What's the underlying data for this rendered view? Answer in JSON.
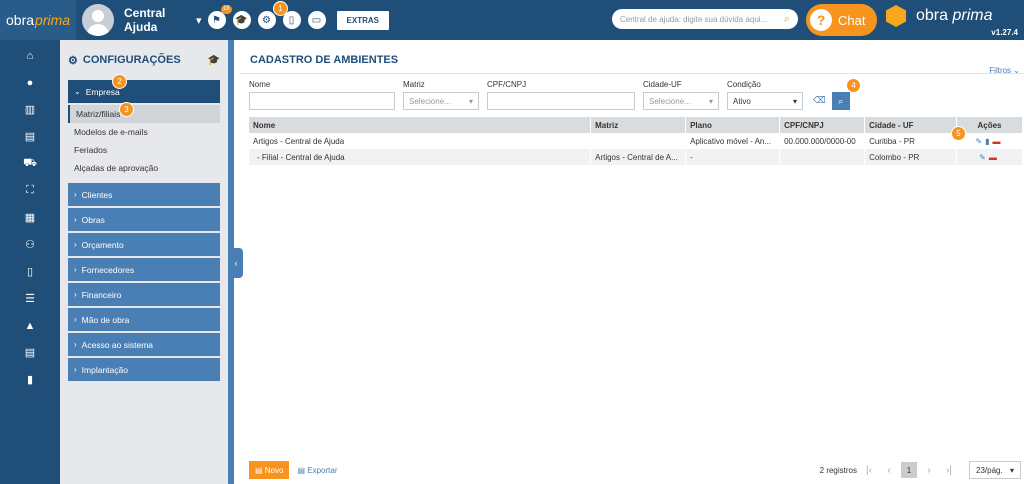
{
  "topbar": {
    "logo_a": "obra",
    "logo_b": "prima",
    "user_line1": "Central",
    "user_line2": "Ajuda",
    "notification_count": "18",
    "extras_label": "EXTRAS",
    "search_placeholder": "Central de ajuda: digite sua dúvida aqui...",
    "chat_label": "Chat",
    "brand_a": "obra",
    "brand_b": "prima",
    "version": "v1.27.4"
  },
  "sidebar": {
    "title": "CONFIGURAÇÕES",
    "active_group": "Empresa",
    "subitems": [
      "Matriz/filiais",
      "Modelos de e-mails",
      "Feriados",
      "Alçadas de aprovação"
    ],
    "groups": [
      "Clientes",
      "Obras",
      "Orçamento",
      "Fornecedores",
      "Financeiro",
      "Mão de obra",
      "Acesso ao sistema",
      "Implantação"
    ]
  },
  "main": {
    "title": "CADASTRO DE AMBIENTES",
    "filters_label": "Filtros",
    "form": {
      "nome_label": "Nome",
      "matriz_label": "Matriz",
      "matriz_placeholder": "Selecione...",
      "cpf_label": "CPF/CNPJ",
      "cidade_label": "Cidade-UF",
      "cidade_placeholder": "Selecione...",
      "condicao_label": "Condição",
      "condicao_value": "Ativo"
    },
    "table": {
      "headers": [
        "Nome",
        "Matriz",
        "Plano",
        "CPF/CNPJ",
        "Cidade - UF",
        "Ações"
      ],
      "rows": [
        {
          "nome": "Artigos - Central de Ajuda",
          "matriz": "",
          "plano": "Aplicativo móvel - An...",
          "cpf": "00.000.000/0000-00",
          "cidade": "Curitiba - PR"
        },
        {
          "nome": "- Filial - Central de Ajuda",
          "matriz": "Artigos - Central de A...",
          "plano": "-",
          "cpf": "",
          "cidade": "Colombo - PR"
        }
      ]
    },
    "bottom": {
      "new_label": "Novo",
      "export_label": "Exportar",
      "records": "2 registros",
      "current_page": "1",
      "per_page": "23/pág."
    }
  },
  "callouts": [
    "1",
    "2",
    "3",
    "4",
    "5"
  ]
}
